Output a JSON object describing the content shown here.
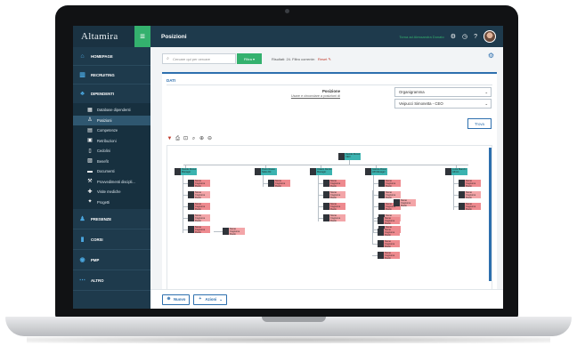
{
  "app": {
    "brand": "Altamira",
    "page_title": "Posizioni",
    "user_link": "Torna ad Alessandra Donato"
  },
  "sidebar": {
    "items": [
      {
        "label": "HOMEPAGE",
        "icon": "home-icon"
      },
      {
        "label": "RECRUITING",
        "icon": "bar-chart-icon"
      },
      {
        "label": "DIPENDENTI",
        "icon": "people-icon"
      }
    ],
    "sub_items": [
      {
        "label": "Database dipendenti",
        "icon": "grid-icon"
      },
      {
        "label": "Posizioni",
        "icon": "org-chart-icon"
      },
      {
        "label": "Competenze",
        "icon": "list-icon"
      },
      {
        "label": "Retribuzioni",
        "icon": "wallet-icon"
      },
      {
        "label": "Cedolini",
        "icon": "document-icon"
      },
      {
        "label": "Benefit",
        "icon": "gift-icon"
      },
      {
        "label": "Documenti",
        "icon": "folder-icon"
      },
      {
        "label": "Provvedimenti discipli...",
        "icon": "gavel-icon"
      },
      {
        "label": "Visite mediche",
        "icon": "medical-icon"
      },
      {
        "label": "Progetti",
        "icon": "lightbulb-icon"
      }
    ],
    "bottom_items": [
      {
        "label": "PRESENZE",
        "icon": "clock-people-icon"
      },
      {
        "label": "CORSI",
        "icon": "book-icon"
      },
      {
        "label": "PMP",
        "icon": "target-icon"
      },
      {
        "label": "ALTRO",
        "icon": "more-icon"
      }
    ]
  },
  "toolbar": {
    "search_placeholder": "Cercare qui per cercare",
    "filter_label": "Filtra",
    "results_text": "Risultati: 24. Filtro corrente:",
    "reset_label": "Reset"
  },
  "panel": {
    "title": "DATI",
    "position_label": "Posizione",
    "position_hint": "Usare e circondare a posizioni di",
    "select_view": "Organigramma",
    "select_person": "Veipucci Simonetta - CEO",
    "find_label": "Trova"
  },
  "bottom": {
    "new_label": "Nuovo",
    "actions_label": "Azioni"
  },
  "org_nodes": {
    "root": "Davide Russo CEO",
    "heads": [
      "Davide Russo Manager",
      "Pietro Russo Sales Dir.",
      "Ottavio Dentro Manager",
      "Gianna Rossi HR Manager",
      "Lucia Bianchi Admin"
    ],
    "child": "Nome Cognome Ruolo"
  },
  "colors": {
    "sidebar_bg": "#1e3a4c",
    "accent_green": "#34b16e",
    "accent_blue": "#2d6fae",
    "node_teal": "#3bb3b0",
    "node_pink": "#ee8a8f"
  }
}
